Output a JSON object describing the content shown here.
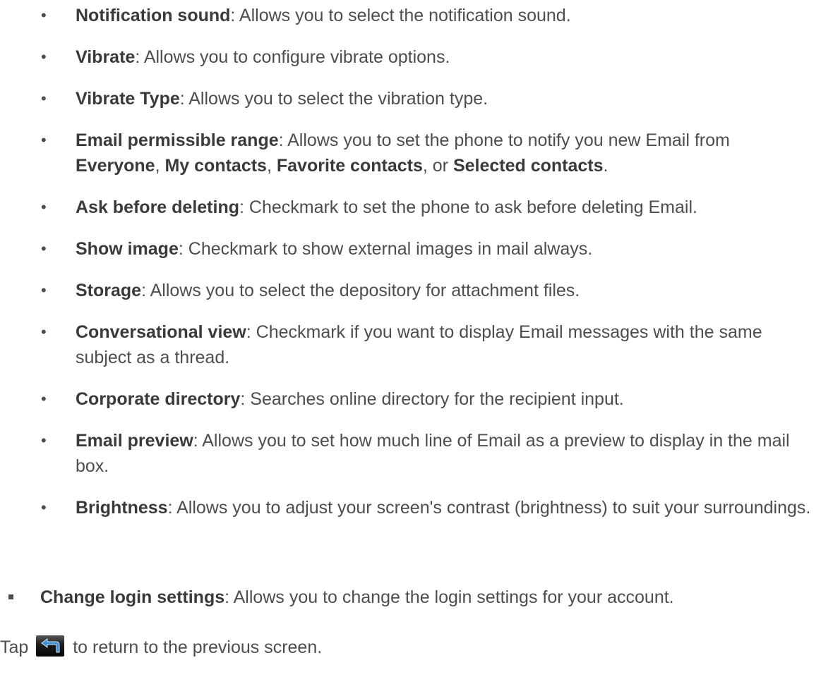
{
  "sub_items": [
    {
      "term": "Notification sound",
      "desc": ": Allows you to select the notification sound."
    },
    {
      "term": "Vibrate",
      "desc": ": Allows you to configure vibrate options."
    },
    {
      "term": "Vibrate Type",
      "desc": ": Allows you to select the vibration type."
    },
    {
      "term": "Email permissible range",
      "desc": ": Allows you to set the phone to notify you new Email from ",
      "opt1": "Everyone",
      "sep1": ", ",
      "opt2": "My contacts",
      "sep2": ", ",
      "opt3": "Favorite contacts",
      "sep3": ", or ",
      "opt4": "Selected contacts",
      "end": "."
    },
    {
      "term": "Ask before deleting",
      "desc": ": Checkmark to set the phone to ask before deleting Email."
    },
    {
      "term": "Show image",
      "desc": ": Checkmark to show external images in mail always."
    },
    {
      "term": "Storage",
      "desc": ": Allows you to select the depository for attachment files."
    },
    {
      "term": "Conversational view",
      "desc": ": Checkmark if you want to display Email messages with the same subject as a thread."
    },
    {
      "term": "Corporate directory",
      "desc": ": Searches online directory for the recipient input."
    },
    {
      "term": "Email preview",
      "desc": ": Allows you to set how much line of Email as a preview to display in the mail box."
    },
    {
      "term": "Brightness",
      "desc": ": Allows you to adjust your screen's contrast (brightness) to suit your surroundings."
    }
  ],
  "bullet_char": "•",
  "top_item": {
    "term": "Change login settings",
    "desc": ": Allows you to change the login settings for your account."
  },
  "tap_line": {
    "before": "Tap ",
    "icon": "back-icon",
    "after": " to return to the previous screen."
  }
}
